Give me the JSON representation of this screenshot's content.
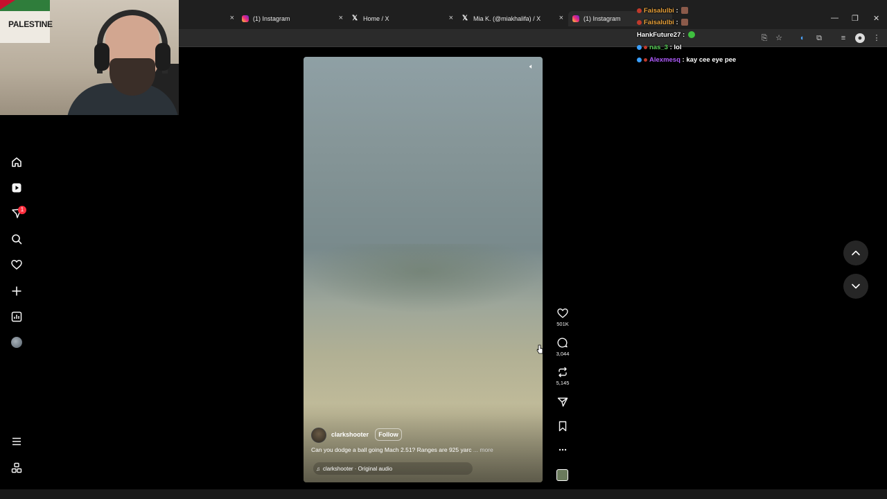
{
  "browser": {
    "tabs": [
      {
        "title": "",
        "icon": "instagram-icon"
      },
      {
        "title": "(1) Instagram",
        "icon": "instagram-icon"
      },
      {
        "title": "Home / X",
        "icon": "x-logo-icon"
      },
      {
        "title": "Mia K. (@miakhalifa) / X",
        "icon": "x-logo-icon"
      },
      {
        "title": "(1) Instagram",
        "icon": "instagram-icon"
      }
    ],
    "close_glyph": "×"
  },
  "webcam": {
    "flag_text": "PALESTINE"
  },
  "sidebar": {
    "items": [
      "home-icon",
      "reels-icon",
      "explore-icon",
      "search-icon",
      "notifications-icon",
      "create-icon",
      "dashboard-icon",
      "profile-avatar",
      "menu-icon",
      "more-apps-icon"
    ],
    "notification_count": "1"
  },
  "reel": {
    "owner": "clarkshooter",
    "follow_label": "Follow",
    "caption": "Can you dodge a ball going Mach 2.51? Ranges are 925 yarc",
    "caption_more": "... more",
    "audio": "clarkshooter · Original audio",
    "likes": "501K",
    "comments": "3,044",
    "reposts": "5,145"
  },
  "chat": {
    "messages": [
      {
        "user": "Faisalulbi",
        "text": "",
        "color": "#e9a23b"
      },
      {
        "user": "Faisalulbi",
        "text": "",
        "color": "#e9a23b"
      },
      {
        "user": "HankFuture27",
        "text": "",
        "color": "#ffffff"
      },
      {
        "user": "nas_3",
        "text": "lol",
        "color": "#5bd35b"
      },
      {
        "user": "Alexmesq",
        "text": "kay cee eye pee",
        "color": "#b05cff"
      }
    ],
    "separator": " : "
  },
  "colors": {
    "badge": "#ff3040",
    "background": "#000000"
  }
}
